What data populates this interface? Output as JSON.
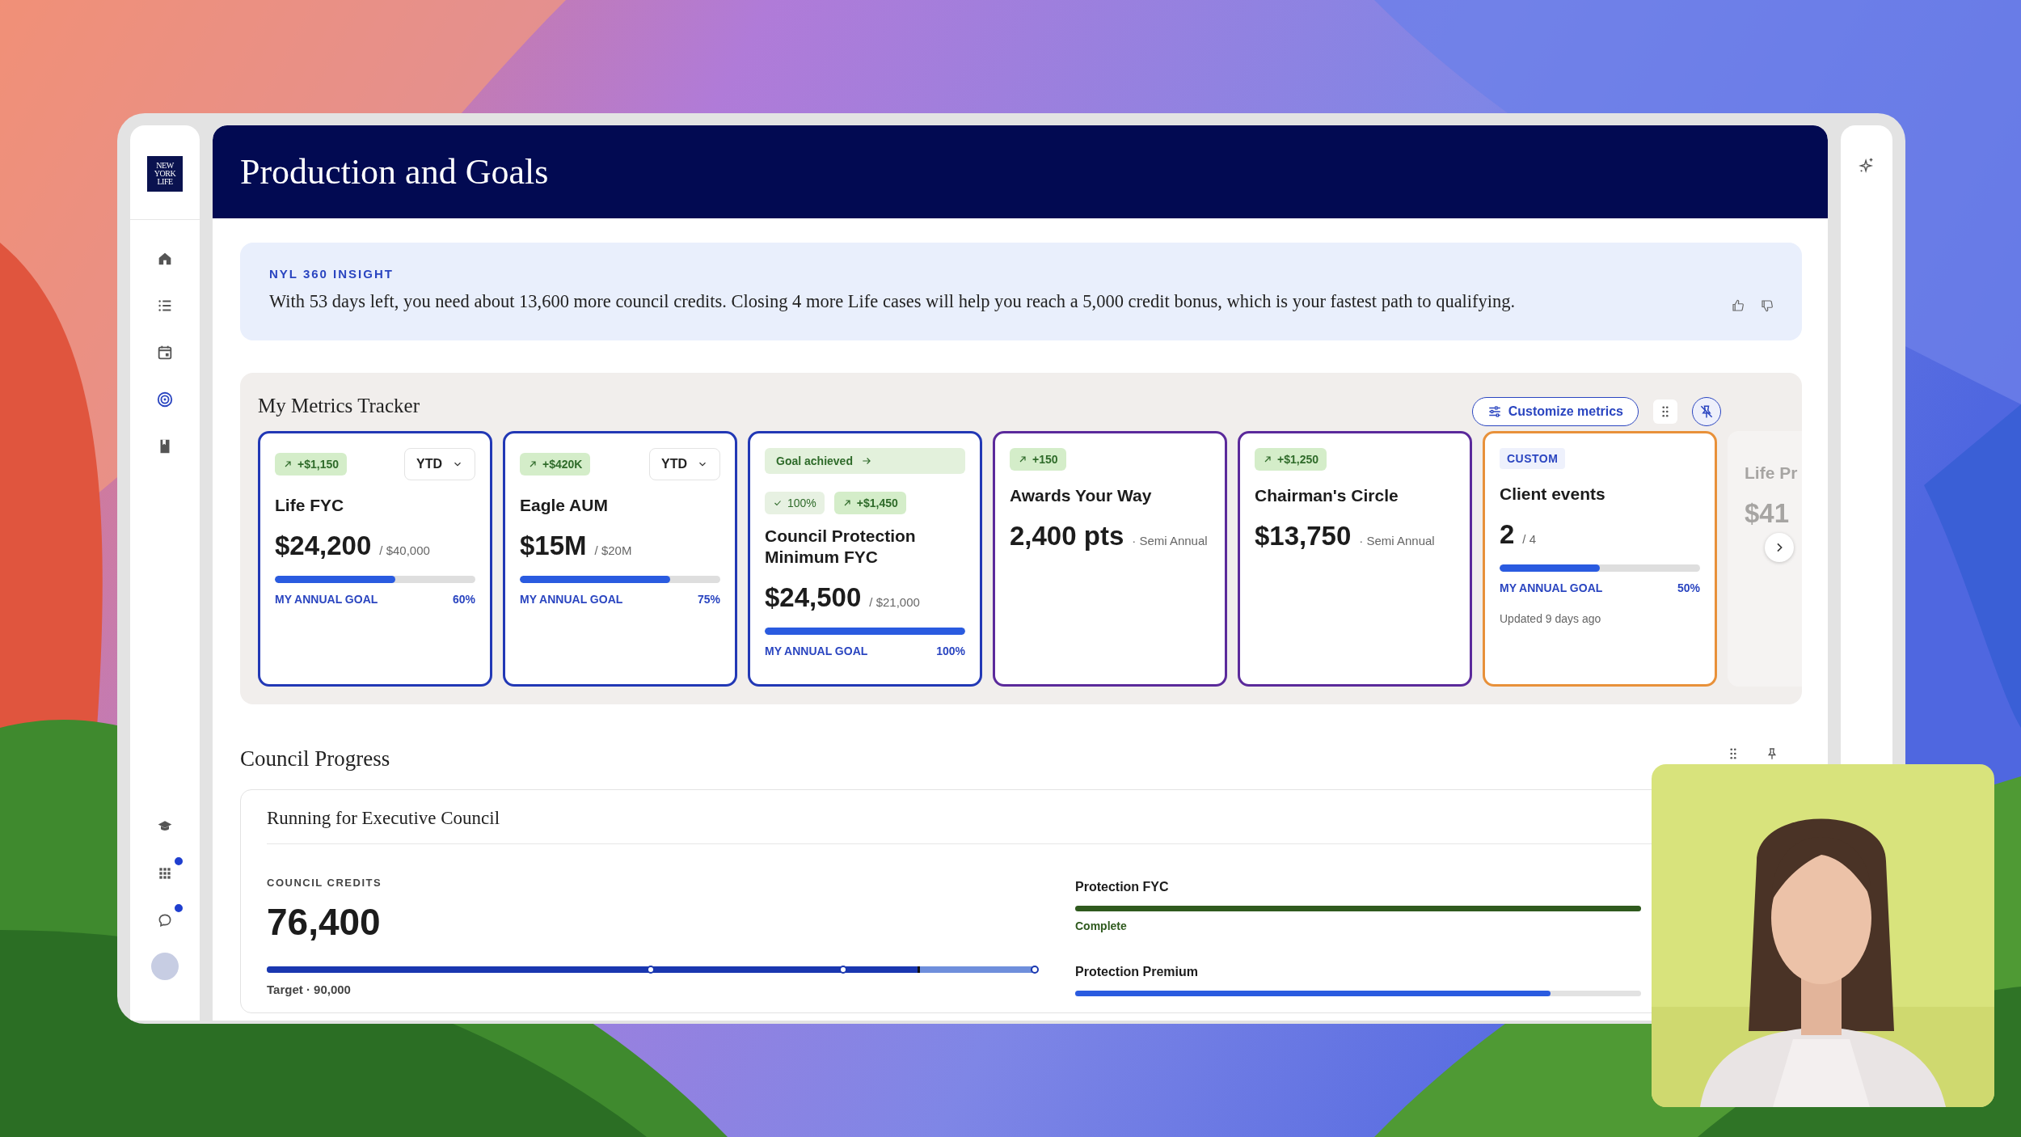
{
  "sidebar": {
    "logo": [
      "NEW",
      "YORK",
      "LIFE"
    ],
    "items": [
      {
        "kind": "home",
        "selected": false
      },
      {
        "kind": "list",
        "selected": false
      },
      {
        "kind": "calendar",
        "selected": false
      },
      {
        "kind": "target",
        "selected": true
      },
      {
        "kind": "book",
        "selected": false
      }
    ],
    "bottom_items": [
      {
        "kind": "school",
        "notification": false
      },
      {
        "kind": "apps",
        "notification": true
      },
      {
        "kind": "chat",
        "notification": true
      },
      {
        "kind": "avatar",
        "notification": false
      }
    ]
  },
  "header": {
    "title": "Production and Goals"
  },
  "insight": {
    "label": "NYL 360 INSIGHT",
    "text": "With 53 days left, you need about 13,600 more council credits. Closing 4 more Life cases will help you reach a 5,000 credit bonus, which is your fastest path to qualifying."
  },
  "metrics": {
    "title": "My Metrics Tracker",
    "customize_button": "Customize metrics",
    "cards": [
      {
        "color": "#2238b5",
        "change": "+$1,150",
        "period": "YTD",
        "title": "Life FYC",
        "value": "$24,200",
        "target": "/ $40,000",
        "level": 0.6,
        "goal_label": "MY ANNUAL GOAL",
        "percent": "60%"
      },
      {
        "color": "#2238b5",
        "change": "+$420K",
        "period": "YTD",
        "title": "Eagle AUM",
        "value": "$15M",
        "target": "/ $20M",
        "level": 0.75,
        "goal_label": "MY ANNUAL GOAL",
        "percent": "75%"
      },
      {
        "color": "#2238b5",
        "status": "Goal achieved",
        "check": "100%",
        "change": "+$1,450",
        "title": "Council Protection Minimum FYC",
        "value": "$24,500",
        "target": "/ $21,000",
        "level": 1,
        "goal_label": "MY ANNUAL GOAL",
        "percent": "100%"
      },
      {
        "color": "#5b2a9b",
        "change": "+150",
        "title": "Awards Your Way",
        "value": "2,400 pts",
        "note": "· Semi Annual"
      },
      {
        "color": "#5b2a9b",
        "change": "+$1,250",
        "title": "Chairman's Circle",
        "value": "$13,750",
        "note": "· Semi Annual"
      },
      {
        "color": "#e8913a",
        "tag": "CUSTOM",
        "title": "Client events",
        "value": "2",
        "target": "/ 4",
        "level": 0.5,
        "goal_label": "MY ANNUAL GOAL",
        "percent": "50%",
        "updated": "Updated 9 days ago"
      },
      {
        "faded": true,
        "title": "Life Pr",
        "value": "$41"
      }
    ]
  },
  "council": {
    "title": "Council Progress",
    "card": {
      "title": "Running for Executive Council",
      "credits_label": "COUNCIL CREDITS",
      "credits": "76,400",
      "level": 0.85,
      "target": "Target · 90,000",
      "goals": [
        {
          "name": "Protection FYC",
          "level": 1,
          "status": "Complete",
          "color": "#2f5a1e"
        },
        {
          "name": "Protection Premium",
          "level": 0.84,
          "color": "#2a5be0"
        }
      ]
    }
  }
}
